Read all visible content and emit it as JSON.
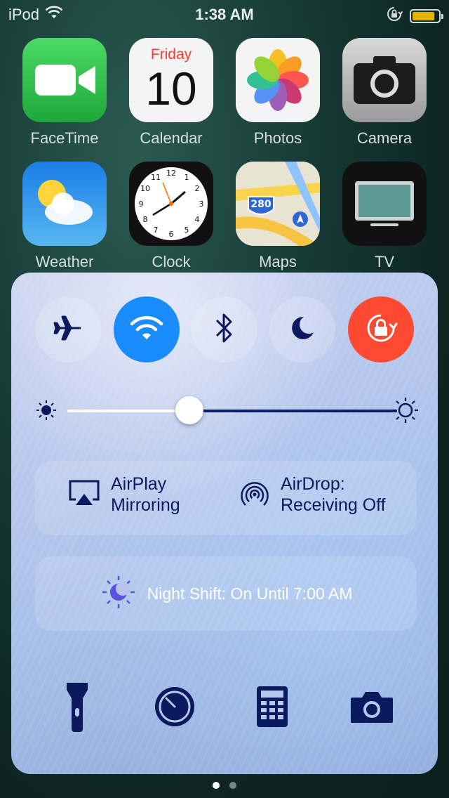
{
  "status_bar": {
    "carrier": "iPod",
    "time": "1:38 AM",
    "battery_level": 0.85,
    "battery_color": "#e2b400"
  },
  "home_screen": {
    "apps_row1": [
      {
        "label": "FaceTime",
        "icon": "facetime-icon"
      },
      {
        "label": "Calendar",
        "icon": "calendar-icon",
        "weekday": "Friday",
        "day": "10"
      },
      {
        "label": "Photos",
        "icon": "photos-icon"
      },
      {
        "label": "Camera",
        "icon": "camera-app-icon"
      }
    ],
    "apps_row2": [
      {
        "label": "Weather",
        "icon": "weather-icon"
      },
      {
        "label": "Clock",
        "icon": "clock-icon"
      },
      {
        "label": "Maps",
        "icon": "maps-icon",
        "badge": "280"
      },
      {
        "label": "TV",
        "icon": "tv-icon"
      }
    ]
  },
  "control_center": {
    "toggles": [
      {
        "name": "airplane-mode",
        "icon": "airplane-icon",
        "active": false
      },
      {
        "name": "wifi",
        "icon": "wifi-icon",
        "active": true,
        "color": "#1a8cff"
      },
      {
        "name": "bluetooth",
        "icon": "bluetooth-icon",
        "active": false
      },
      {
        "name": "do-not-disturb",
        "icon": "moon-icon",
        "active": false
      },
      {
        "name": "orientation-lock",
        "icon": "rotation-lock-icon",
        "active": true,
        "color": "#ff4a33"
      }
    ],
    "brightness_level": 0.37,
    "airplay": {
      "line1": "AirPlay",
      "line2": "Mirroring"
    },
    "airdrop": {
      "line1": "AirDrop:",
      "line2": "Receiving Off"
    },
    "night_shift": "Night Shift: On Until 7:00 AM",
    "tools": [
      {
        "name": "flashlight",
        "icon": "flashlight-icon"
      },
      {
        "name": "timer",
        "icon": "timer-icon"
      },
      {
        "name": "calculator",
        "icon": "calculator-icon"
      },
      {
        "name": "camera",
        "icon": "camera-icon"
      }
    ],
    "text_color": "#0b1a5e"
  },
  "page_dots": {
    "count": 2,
    "current": 1
  }
}
